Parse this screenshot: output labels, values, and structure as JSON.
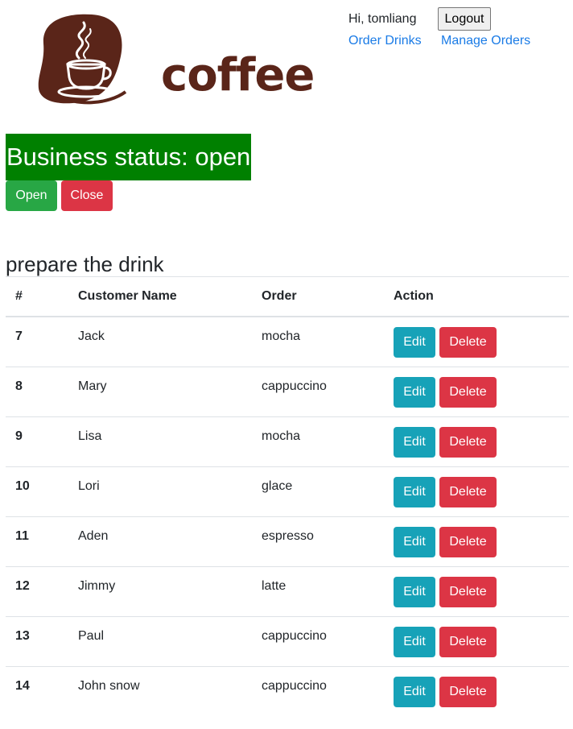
{
  "header": {
    "logo_text": "coffee",
    "greeting": "Hi, tomliang",
    "logout_label": "Logout",
    "nav": [
      {
        "label": "Order Drinks"
      },
      {
        "label": "Manage Orders"
      }
    ]
  },
  "status": {
    "banner_text": "Business status: open",
    "open_label": "Open",
    "close_label": "Close"
  },
  "section": {
    "title": "prepare the drink"
  },
  "table": {
    "headers": [
      "#",
      "Customer Name",
      "Order",
      "Action"
    ],
    "edit_label": "Edit",
    "delete_label": "Delete",
    "rows": [
      {
        "id": "7",
        "name": "Jack",
        "order": "mocha"
      },
      {
        "id": "8",
        "name": "Mary",
        "order": "cappuccino"
      },
      {
        "id": "9",
        "name": "Lisa",
        "order": "mocha"
      },
      {
        "id": "10",
        "name": "Lori",
        "order": "glace"
      },
      {
        "id": "11",
        "name": "Aden",
        "order": "espresso"
      },
      {
        "id": "12",
        "name": "Jimmy",
        "order": "latte"
      },
      {
        "id": "13",
        "name": "Paul",
        "order": "cappuccino"
      },
      {
        "id": "14",
        "name": "John snow",
        "order": "cappuccino"
      }
    ]
  },
  "colors": {
    "status_open_bg": "#008000",
    "success": "#28a745",
    "danger": "#dc3545",
    "info": "#17a2b8",
    "link": "#1a7be6",
    "brand_brown": "#5a2519"
  }
}
